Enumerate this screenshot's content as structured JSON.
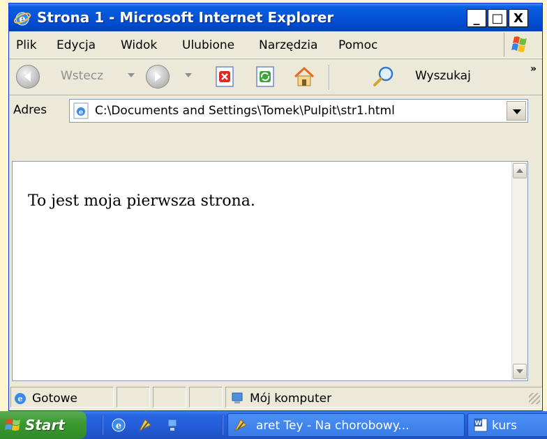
{
  "window": {
    "title": "Strona 1 - Microsoft Internet Explorer",
    "controls": {
      "minimize": "_",
      "maximize": "□",
      "close": "X"
    }
  },
  "menu": [
    "Plik",
    "Edycja",
    "Widok",
    "Ulubione",
    "Narzędzia",
    "Pomoc"
  ],
  "toolbar": {
    "back_label": "Wstecz",
    "search_label": "Wyszukaj",
    "more": "»",
    "icons": [
      "back-icon",
      "forward-icon",
      "stop-icon",
      "refresh-icon",
      "home-icon",
      "search-icon"
    ]
  },
  "address": {
    "label": "Adres",
    "value": "C:\\Documents and Settings\\Tomek\\Pulpit\\str1.html"
  },
  "content": {
    "text": "To jest moja pierwsza strona."
  },
  "status": {
    "text": "Gotowe",
    "zone": "Mój komputer"
  },
  "taskbar": {
    "start_label": "Start",
    "tasks": [
      {
        "label": "aret Tey - Na chorobowy...",
        "icon": "winamp-icon"
      },
      {
        "label": "kurs",
        "icon": "word-icon"
      }
    ]
  },
  "colors": {
    "title_blue": "#0553d6",
    "window_bg": "#ece9d8",
    "start_green": "#3c9b33",
    "taskbar_blue": "#245edb"
  }
}
